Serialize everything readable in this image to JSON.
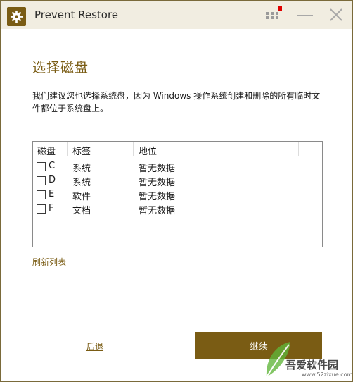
{
  "window": {
    "title": "Prevent Restore",
    "icon": "gear-icon"
  },
  "titlebar": {
    "more_icon": "more-dots-icon",
    "minimize_icon": "minimize-icon",
    "close_icon": "close-icon",
    "notification_color": "#e00000"
  },
  "page": {
    "heading": "选择磁盘",
    "description": "我们建议您也选择系统盘，因为 Windows 操作系统创建和删除的所有临时文件都位于系统盘上。"
  },
  "disk_list": {
    "columns": [
      "磁盘",
      "标签",
      "地位"
    ],
    "rows": [
      {
        "checked": false,
        "disk": "C",
        "label": "系统",
        "status": "暂无数据"
      },
      {
        "checked": false,
        "disk": "D",
        "label": "系统",
        "status": "暂无数据"
      },
      {
        "checked": false,
        "disk": "E",
        "label": "软件",
        "status": "暂无数据"
      },
      {
        "checked": false,
        "disk": "F",
        "label": "文档",
        "status": "暂无数据"
      }
    ]
  },
  "actions": {
    "refresh": "刷新列表",
    "back": "后退",
    "continue": "继续"
  },
  "watermark": {
    "text": "吾爱软件园",
    "url": "www.52zixue.com"
  },
  "colors": {
    "accent": "#7a5c14",
    "titlebar_bg": "#f1ede1"
  }
}
